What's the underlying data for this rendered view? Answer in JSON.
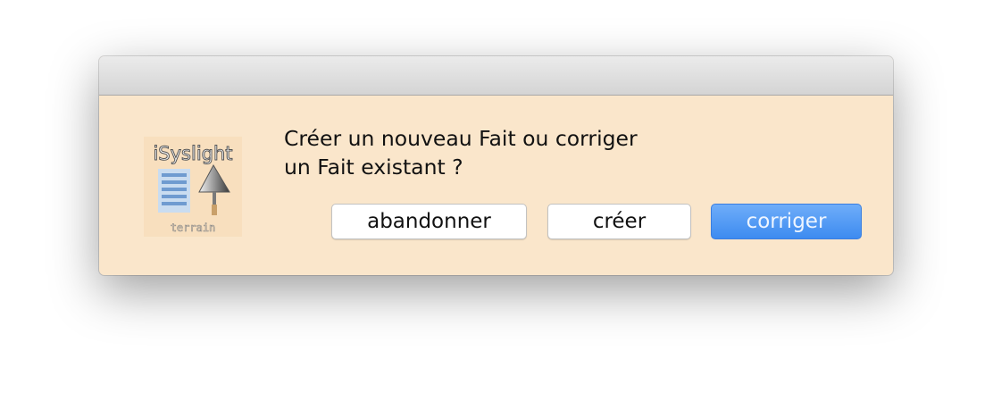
{
  "dialog": {
    "message_line1": "Créer un nouveau Fait ou corriger",
    "message_line2": "un Fait existant ?",
    "app_icon": {
      "name": "isyslight-icon",
      "brand_text": "iSyslight",
      "caption_text": "terrain"
    },
    "buttons": {
      "cancel_label": "abandonner",
      "create_label": "créer",
      "correct_label": "corriger"
    }
  },
  "colors": {
    "dialog_background": "#fae6cb",
    "primary_button": "#4a94f3"
  }
}
